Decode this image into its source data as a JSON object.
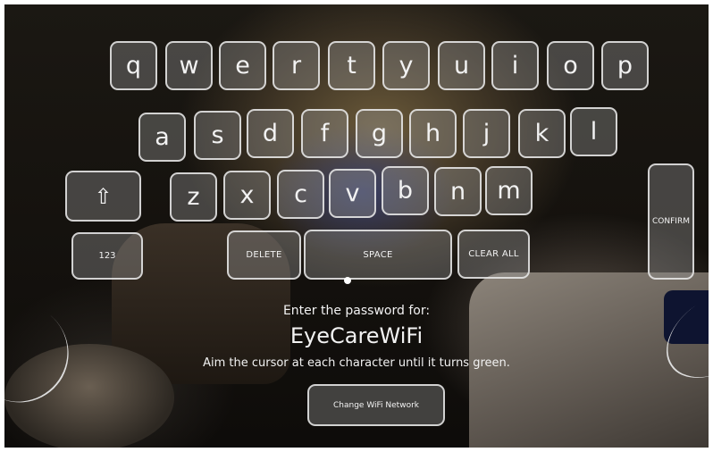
{
  "keyboard": {
    "row1": [
      "q",
      "w",
      "e",
      "r",
      "t",
      "y",
      "u",
      "i",
      "o",
      "p"
    ],
    "row2": [
      "a",
      "s",
      "d",
      "f",
      "g",
      "h",
      "j",
      "k",
      "l"
    ],
    "row3": [
      "z",
      "x",
      "c",
      "v",
      "b",
      "n",
      "m"
    ],
    "numbers_label": "123",
    "delete_label": "DELETE",
    "space_label": "SPACE",
    "clear_all_label": "CLEAR ALL",
    "confirm_label": "CONFIRM",
    "shift_glyph": "⇧"
  },
  "prompt": {
    "line1": "Enter the password for:",
    "network_name": "EyeCareWiFi",
    "instruction": "Aim the cursor at each character until it turns green."
  },
  "change_network_label": "Change WiFi Network"
}
